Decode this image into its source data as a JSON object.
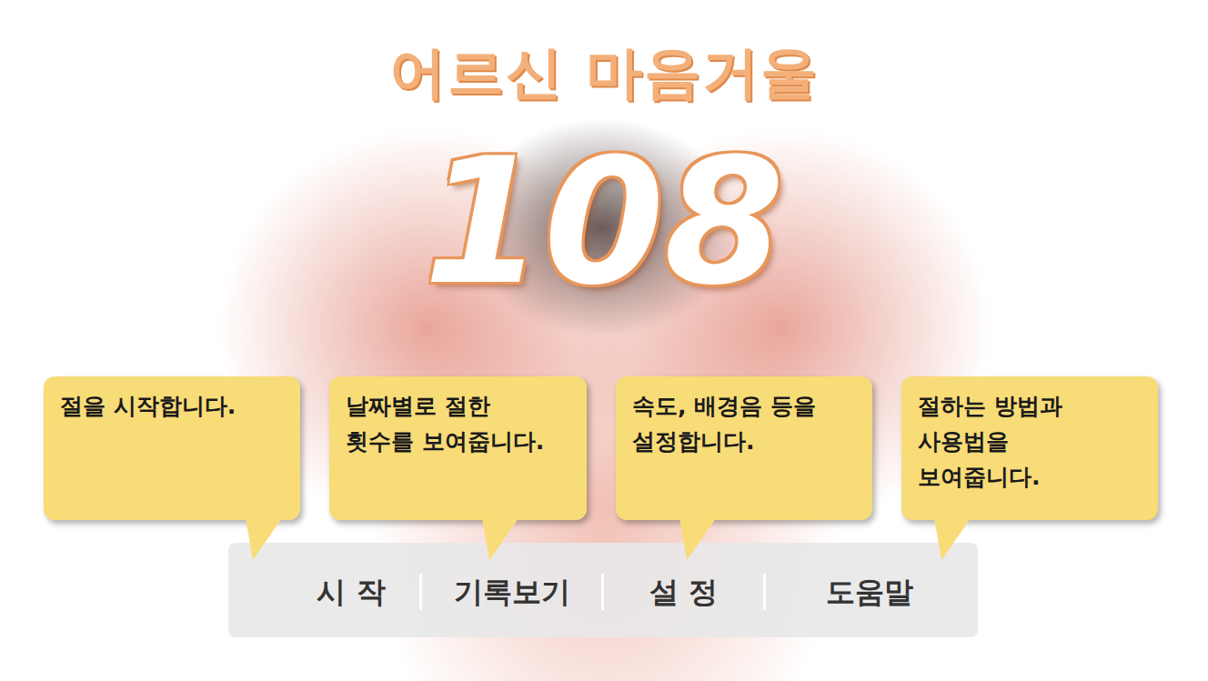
{
  "app": {
    "title": "어르신 마음거울",
    "number": "108"
  },
  "callouts": [
    {
      "text": "절을 시작합니다."
    },
    {
      "text": "날짜별로 절한\n횟수를 보여줍니다."
    },
    {
      "text": "속도, 배경음 등을\n설정합니다."
    },
    {
      "text": "절하는 방법과\n사용법을\n보여줍니다."
    }
  ],
  "menu": [
    {
      "label": "시 작"
    },
    {
      "label": "기록보기"
    },
    {
      "label": "설 정"
    },
    {
      "label": "도움말"
    }
  ]
}
